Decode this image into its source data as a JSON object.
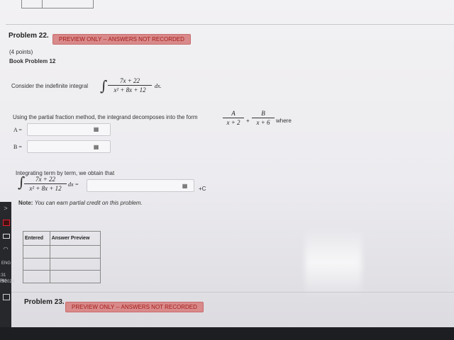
{
  "problem22": {
    "title": "Problem 22.",
    "badge": "PREVIEW ONLY -- ANSWERS NOT RECORDED",
    "points": "(4 points)",
    "book": "Book Problem 12",
    "consider_text": "Consider the indefinite integral",
    "integrand_num": "7x + 22",
    "integrand_den": "x² + 8x + 12",
    "dx": "dx.",
    "decompose_text": "Using the partial fraction method, the integrand decomposes into the form",
    "frac_a_num": "A",
    "frac_a_den": "x + 2",
    "plus": "+",
    "frac_b_num": "B",
    "frac_b_den": "x + 6",
    "where": "where",
    "a_label": "A =",
    "b_label": "B =",
    "a_value": "",
    "b_value": "",
    "integrating_text": "Integrating term by term, we obtain that",
    "dx_eq": "dx =",
    "integral_value": "",
    "plus_c": "+C",
    "note_label": "Note:",
    "note_text": "You can earn partial credit on this problem.",
    "table_headers": [
      "Entered",
      "Answer Preview"
    ],
    "table_rows": [
      [
        "",
        ""
      ],
      [
        "",
        ""
      ],
      [
        "",
        ""
      ]
    ],
    "keyboard_icon": "▦"
  },
  "problem23": {
    "title": "Problem 23.",
    "badge": "PREVIEW ONLY -- ANSWERS NOT RECORDED"
  },
  "taskbar": {
    "lang": "ENG",
    "time": ":31 PM",
    "date": "/3/2020"
  }
}
